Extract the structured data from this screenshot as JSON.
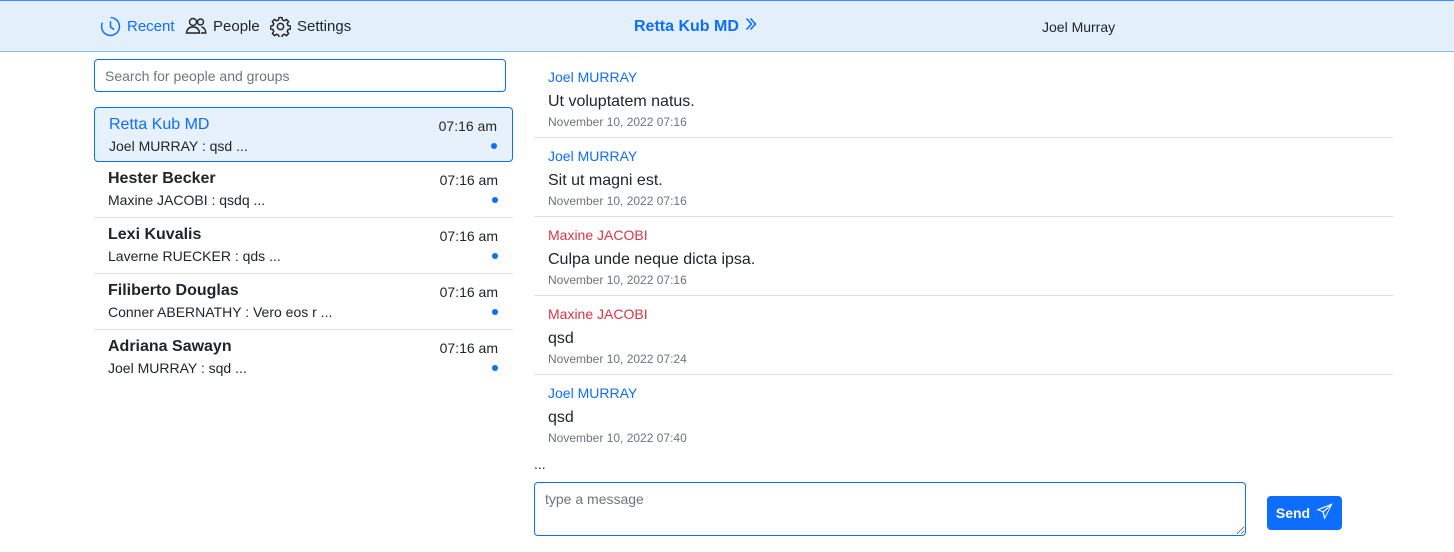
{
  "nav": {
    "recent_label": "Recent",
    "people_label": "People",
    "settings_label": "Settings"
  },
  "header": {
    "conversation_title": "Retta Kub MD",
    "current_user": "Joel Murray"
  },
  "search": {
    "placeholder": "Search for people and groups"
  },
  "conversations": [
    {
      "name": "Retta Kub MD",
      "time": "07:16 am",
      "preview": "Joel MURRAY : qsd ...",
      "active": true
    },
    {
      "name": "Hester Becker",
      "time": "07:16 am",
      "preview": "Maxine JACOBI : qsdq ..."
    },
    {
      "name": "Lexi Kuvalis",
      "time": "07:16 am",
      "preview": "Laverne RUECKER : qds ..."
    },
    {
      "name": "Filiberto Douglas",
      "time": "07:16 am",
      "preview": "Conner ABERNATHY : Vero eos r ..."
    },
    {
      "name": "Adriana Sawayn",
      "time": "07:16 am",
      "preview": "Joel MURRAY : sqd ..."
    }
  ],
  "messages": [
    {
      "author": "Joel MURRAY",
      "author_color": "#0d6efd",
      "text": "Ut voluptatem natus.",
      "date": "November 10, 2022 07:16"
    },
    {
      "author": "Joel MURRAY",
      "author_color": "#0d6efd",
      "text": "Sit ut magni est.",
      "date": "November 10, 2022 07:16"
    },
    {
      "author": "Maxine JACOBI",
      "author_color": "#dc3545",
      "text": "Culpa unde neque dicta ipsa.",
      "date": "November 10, 2022 07:16"
    },
    {
      "author": "Maxine JACOBI",
      "author_color": "#dc3545",
      "text": "qsd",
      "date": "November 10, 2022 07:24"
    },
    {
      "author": "Joel MURRAY",
      "author_color": "#0d6efd",
      "text": "qsd",
      "date": "November 10, 2022 07:40"
    }
  ],
  "typing_indicator": "...",
  "composer": {
    "placeholder": "type a message",
    "send_label": "Send"
  },
  "colors": {
    "accent": "#0d6efd",
    "danger": "#dc3545",
    "header_bg": "#e3f0fb"
  },
  "icons": {
    "recent": "clock-icon",
    "people": "people-icon",
    "settings": "gear-icon",
    "title": "chevron-double-right-icon",
    "send": "send-icon"
  }
}
